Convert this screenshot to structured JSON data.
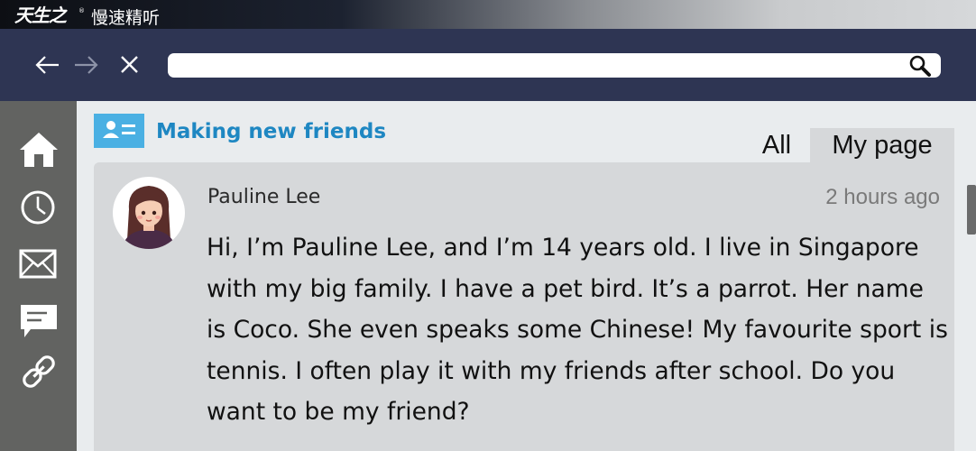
{
  "brand": {
    "logo_text": "天生之",
    "registered_mark": "®",
    "title": "慢速精听"
  },
  "browser": {
    "back_icon": "arrow-left-icon",
    "forward_icon": "arrow-right-icon",
    "stop_icon": "close-icon",
    "url_value": "",
    "search_icon": "search-icon"
  },
  "sidebar": {
    "items": [
      {
        "icon": "home-icon"
      },
      {
        "icon": "clock-icon"
      },
      {
        "icon": "mail-icon"
      },
      {
        "icon": "chat-icon"
      },
      {
        "icon": "link-icon"
      }
    ]
  },
  "section": {
    "icon": "contact-card-icon",
    "title": "Making new friends"
  },
  "tabs": [
    {
      "label": "All",
      "active": false
    },
    {
      "label": "My page",
      "active": true
    }
  ],
  "post": {
    "author": "Pauline Lee",
    "time": "2 hours ago",
    "avatar_icon": "girl-avatar-icon",
    "body": "Hi, I’m Pauline Lee, and I’m 14 years old. I live in Singapore with my big family. I have a pet bird. It’s a parrot. Her name is Coco. She even speaks some Chinese! My favourite sport is tennis. I often play it with my friends after school. Do you want to be my friend?"
  },
  "colors": {
    "browser_bar": "#2e3553",
    "sidebar": "#626361",
    "accent_blue": "#1e87c2",
    "section_icon_bg": "#4ab0e3",
    "card_bg": "#d6d8da",
    "page_bg": "#e9ecee"
  }
}
